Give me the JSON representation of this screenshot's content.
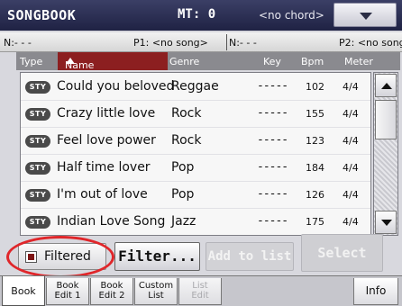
{
  "title_bar": {
    "app_title": "SONGBOOK",
    "master_transpose": "MT: 0",
    "chord": "<no chord>",
    "menu_icon": "triangle-down-icon"
  },
  "players": {
    "p1_left": "N:- - -",
    "p1_label": "P1: <no song>",
    "p2_left": "N:- - -",
    "p2_label": "P2: <no song>"
  },
  "columns": {
    "type": "Type",
    "name": "Name",
    "genre": "Genre",
    "key": "Key",
    "bpm": "Bpm",
    "meter": "Meter",
    "sort_icon": "sort-ascending-icon"
  },
  "rows": [
    {
      "type": "STY",
      "name": "Could you beloved",
      "genre": "Reggae",
      "key": "-----",
      "bpm": "102",
      "meter": "4/4"
    },
    {
      "type": "STY",
      "name": "Crazy little love",
      "genre": "Rock",
      "key": "-----",
      "bpm": "155",
      "meter": "4/4"
    },
    {
      "type": "STY",
      "name": "Feel love power",
      "genre": "Rock",
      "key": "-----",
      "bpm": "123",
      "meter": "4/4"
    },
    {
      "type": "STY",
      "name": "Half time lover",
      "genre": "Pop",
      "key": "-----",
      "bpm": "184",
      "meter": "4/4"
    },
    {
      "type": "STY",
      "name": "I'm out of love",
      "genre": "Pop",
      "key": "-----",
      "bpm": "126",
      "meter": "4/4"
    },
    {
      "type": "STY",
      "name": "Indian Love Song",
      "genre": "Jazz",
      "key": "-----",
      "bpm": "175",
      "meter": "4/4"
    }
  ],
  "controls": {
    "filtered_label": "Filtered",
    "filtered_checked": true,
    "filter_button": "Filter...",
    "add_to_list_button": "Add to list",
    "select_button": "Select"
  },
  "tabs": {
    "book": "Book",
    "book_edit_1_l1": "Book",
    "book_edit_1_l2": "Edit 1",
    "book_edit_2_l1": "Book",
    "book_edit_2_l2": "Edit 2",
    "custom_list_l1": "Custom",
    "custom_list_l2": "List",
    "list_edit_l1": "List",
    "list_edit_l2": "Edit",
    "info": "Info"
  },
  "colors": {
    "title_bar": "#2b2e52",
    "active_column": "#8c1f20",
    "highlight": "#e0262a"
  }
}
